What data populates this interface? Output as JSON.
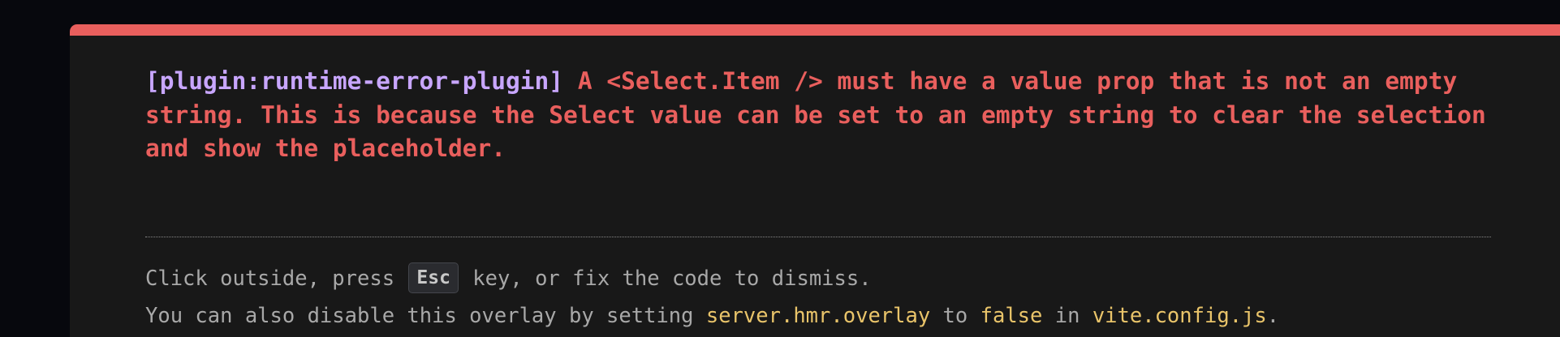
{
  "error": {
    "plugin": "[plugin:runtime-error-plugin]",
    "message": "A <Select.Item /> must have a value prop that is not an empty string. This is because the Select value can be set to an empty string to clear the selection and show the placeholder."
  },
  "tip": {
    "line1_before": "Click outside, press ",
    "key": "Esc",
    "line1_after": " key, or fix the code to dismiss.",
    "line2_part1": "You can also disable this overlay by setting ",
    "line2_code1": "server.hmr.overlay",
    "line2_part2": " to ",
    "line2_code2": "false",
    "line2_part3": " in ",
    "line2_code3": "vite.config.js",
    "line2_part4": "."
  },
  "colors": {
    "accent_bar": "#e95f5d",
    "error_text": "#e95f5d",
    "plugin_text": "#c8a6ff",
    "panel_bg": "#181818",
    "backdrop": "#07080d",
    "code_text": "#e9c46a",
    "tip_text": "#a8a8a8"
  }
}
